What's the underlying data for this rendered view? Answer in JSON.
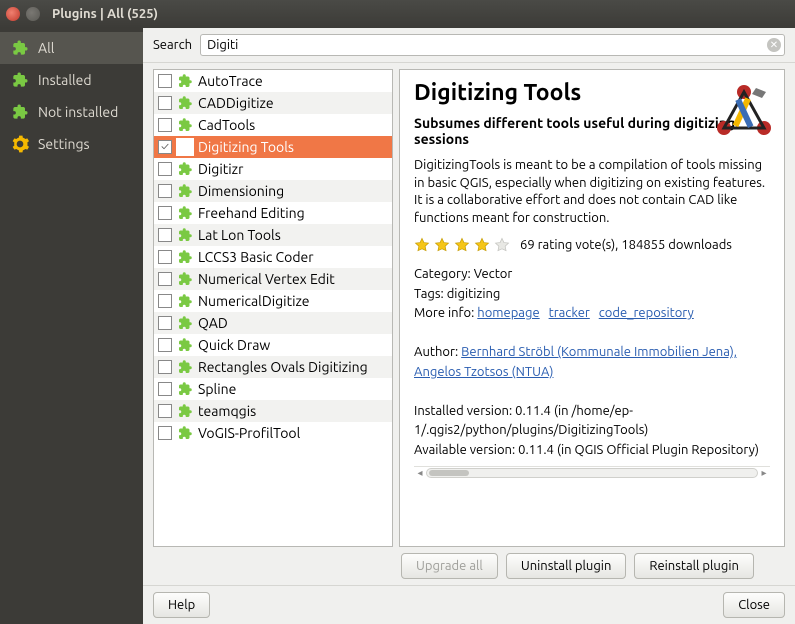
{
  "window": {
    "title": "Plugins | All (525)"
  },
  "nav": {
    "items": [
      {
        "id": "all",
        "label": "All",
        "icon": "puzzle-green",
        "active": true
      },
      {
        "id": "installed",
        "label": "Installed",
        "icon": "puzzle-green"
      },
      {
        "id": "not-installed",
        "label": "Not installed",
        "icon": "puzzle-green"
      },
      {
        "id": "settings",
        "label": "Settings",
        "icon": "gear-icon"
      }
    ]
  },
  "search": {
    "label": "Search",
    "value": "Digiti"
  },
  "plugins": [
    {
      "name": "AutoTrace",
      "checked": false
    },
    {
      "name": "CADDigitize",
      "checked": false
    },
    {
      "name": "CadTools",
      "checked": false
    },
    {
      "name": "Digitizing Tools",
      "checked": true,
      "selected": true,
      "special_icon": true
    },
    {
      "name": "Digitizr",
      "checked": false
    },
    {
      "name": "Dimensioning",
      "checked": false
    },
    {
      "name": "Freehand Editing",
      "checked": false
    },
    {
      "name": "Lat Lon Tools",
      "checked": false
    },
    {
      "name": "LCCS3 Basic Coder",
      "checked": false
    },
    {
      "name": "Numerical Vertex Edit",
      "checked": false
    },
    {
      "name": "NumericalDigitize",
      "checked": false
    },
    {
      "name": "QAD",
      "checked": false
    },
    {
      "name": "Quick Draw",
      "checked": false
    },
    {
      "name": "Rectangles Ovals Digitizing",
      "checked": false
    },
    {
      "name": "Spline",
      "checked": false
    },
    {
      "name": "teamqgis",
      "checked": false
    },
    {
      "name": "VoGIS-ProfilTool",
      "checked": false
    }
  ],
  "detail": {
    "title": "Digitizing Tools",
    "subtitle": "Subsumes different tools useful during digitizing sessions",
    "description": "DigitizingTools is meant to be a compilation of tools missing in basic QGIS, especially when digitizing on existing features. It is a collaborative effort and does not contain CAD like functions meant for construction.",
    "rating_stars": 4,
    "rating_text": "69 rating vote(s), 184855 downloads",
    "category_label": "Category:",
    "category": "Vector",
    "tags_label": "Tags:",
    "tags": "digitizing",
    "moreinfo_label": "More info:",
    "link_homepage": "homepage",
    "link_tracker": "tracker",
    "link_code": "code_repository",
    "author_label": "Author:",
    "author": "Bernhard Ströbl (Kommunale Immobilien Jena), Angelos Tzotsos (NTUA)",
    "installed_version": "Installed version: 0.11.4 (in /home/ep-1/.qgis2/python/plugins/DigitizingTools)",
    "available_version": "Available version: 0.11.4 (in QGIS Official Plugin Repository)"
  },
  "buttons": {
    "upgrade_all": "Upgrade all",
    "uninstall": "Uninstall plugin",
    "reinstall": "Reinstall plugin",
    "help": "Help",
    "close": "Close"
  }
}
